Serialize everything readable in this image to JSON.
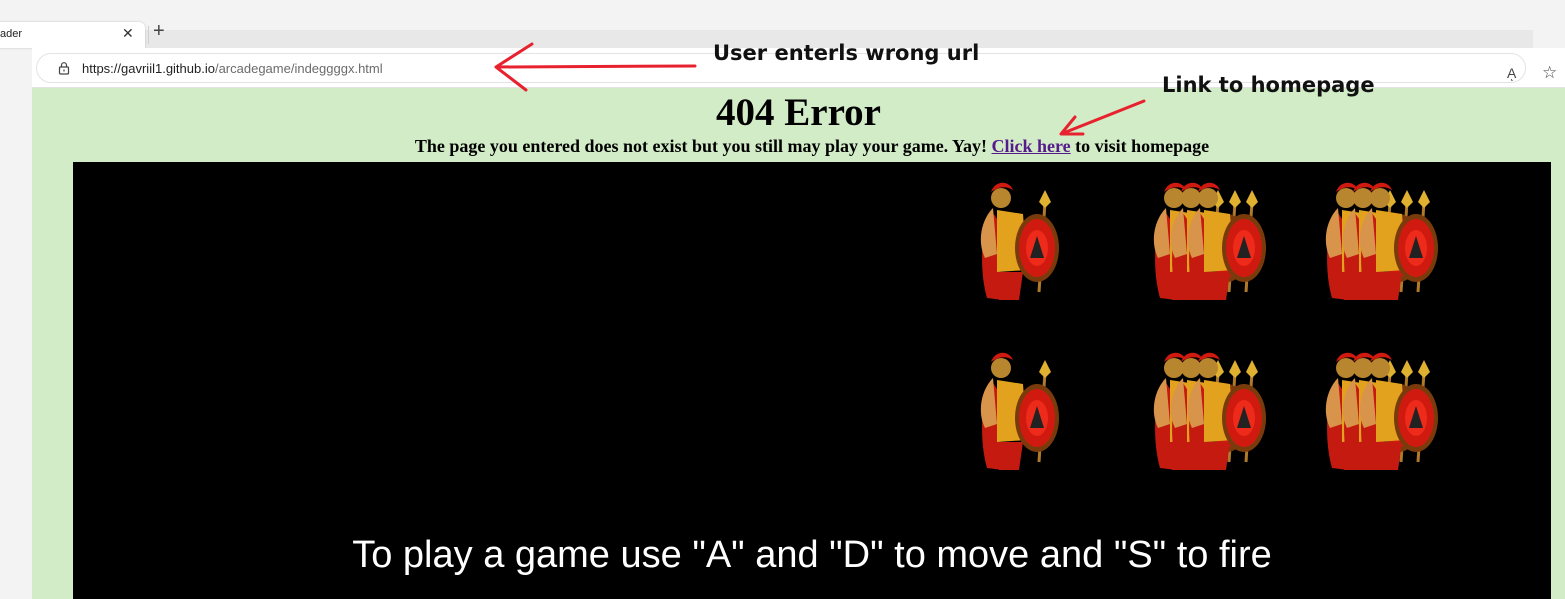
{
  "browser": {
    "tab_title": "ader",
    "tab_close": "✕",
    "new_tab": "+",
    "url_host": "https://gavriil1.github.io",
    "url_path": "/arcadegame/indeggggx.html",
    "read_aloud": "Aͅ",
    "favorite": "☆"
  },
  "page": {
    "heading": "404 Error",
    "subline_before": "The page you entered does not exist but you still may play your game. Yay! ",
    "link_text": "Click here",
    "subline_after": " to visit homepage"
  },
  "game": {
    "instructions": "To play a game use \"A\" and \"D\" to move and \"S\" to fire",
    "enemy_rows": [
      [
        1,
        3,
        3
      ],
      [
        1,
        3,
        3
      ]
    ]
  },
  "annotations": {
    "wrong_url": "User enterls wrong url",
    "homepage_link": "Link to homepage",
    "arrow_color": "#e8212e"
  },
  "icons": [
    "lock-icon",
    "close-icon",
    "plus-icon",
    "read-aloud-icon",
    "favorite-star-icon",
    "spartan-warrior-icon"
  ]
}
